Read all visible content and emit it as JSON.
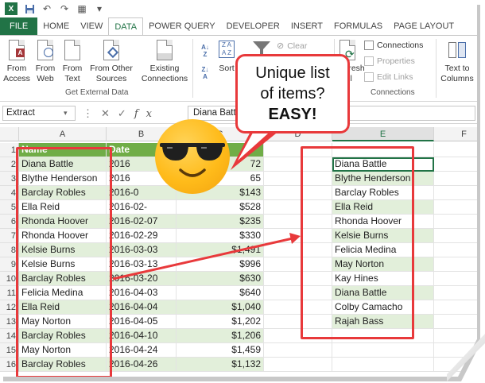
{
  "quick_access": {
    "icons": [
      "excel-logo",
      "save-icon",
      "undo-icon",
      "redo-icon",
      "form-icon",
      "customize-icon"
    ]
  },
  "tabs": [
    "FILE",
    "HOME",
    "VIEW",
    "DATA",
    "POWER QUERY",
    "DEVELOPER",
    "INSERT",
    "FORMULAS",
    "PAGE LAYOUT"
  ],
  "active_tab": "DATA",
  "ribbon": {
    "from_access": "From Access",
    "from_web": "From Web",
    "from_text": "From Text",
    "from_other": "From Other Sources",
    "existing_connections": "Existing Connections",
    "get_external_label": "Get External Data",
    "sort": "Sort",
    "clear": "Clear",
    "refresh": "Refresh All",
    "connections": "Connections",
    "properties": "Properties",
    "edit_links": "Edit Links",
    "connections_label": "Connections",
    "text_to_columns": "Text to Columns"
  },
  "formula_bar": {
    "name_box": "Extract",
    "content": "Diana Battle"
  },
  "columns": [
    "A",
    "B",
    "C",
    "D",
    "E",
    "F"
  ],
  "selected_column": "E",
  "rows": [
    {
      "n": "1",
      "name": "Name",
      "date": "Date",
      "amount": ""
    },
    {
      "n": "2",
      "name": "Diana Battle",
      "date": "2016",
      "amount": "72"
    },
    {
      "n": "3",
      "name": "Blythe Henderson",
      "date": "2016",
      "amount": "65"
    },
    {
      "n": "4",
      "name": "Barclay Robles",
      "date": "2016-0",
      "amount": "$143"
    },
    {
      "n": "5",
      "name": "Ella Reid",
      "date": "2016-02-",
      "amount": "$528"
    },
    {
      "n": "6",
      "name": "Rhonda Hoover",
      "date": "2016-02-07",
      "amount": "$235"
    },
    {
      "n": "7",
      "name": "Rhonda Hoover",
      "date": "2016-02-29",
      "amount": "$330"
    },
    {
      "n": "8",
      "name": "Kelsie Burns",
      "date": "2016-03-03",
      "amount": "$1,491"
    },
    {
      "n": "9",
      "name": "Kelsie Burns",
      "date": "2016-03-13",
      "amount": "$996"
    },
    {
      "n": "10",
      "name": "Barclay Robles",
      "date": "2016-03-20",
      "amount": "$630"
    },
    {
      "n": "11",
      "name": "Felicia Medina",
      "date": "2016-04-03",
      "amount": "$640"
    },
    {
      "n": "12",
      "name": "Ella Reid",
      "date": "2016-04-04",
      "amount": "$1,040"
    },
    {
      "n": "13",
      "name": "May Norton",
      "date": "2016-04-05",
      "amount": "$1,202"
    },
    {
      "n": "14",
      "name": "Barclay Robles",
      "date": "2016-04-10",
      "amount": "$1,206"
    },
    {
      "n": "15",
      "name": "May Norton",
      "date": "2016-04-24",
      "amount": "$1,459"
    },
    {
      "n": "16",
      "name": "Barclay Robles",
      "date": "2016-04-26",
      "amount": "$1,132"
    }
  ],
  "unique_list": [
    "Diana Battle",
    "Blythe Henderson",
    "Barclay Robles",
    "Ella Reid",
    "Rhonda Hoover",
    "Kelsie Burns",
    "Felicia Medina",
    "May Norton",
    "Kay Hines",
    "Diana Battle",
    "Colby Camacho",
    "Rajah Bass"
  ],
  "callout": {
    "line1": "Unique list",
    "line2": "of items?",
    "line3": "EASY!"
  },
  "colors": {
    "excel_green": "#217346",
    "header_green": "#70ad47",
    "band_green": "#e2efda",
    "annotation_red": "#e8393b",
    "emoji_yellow": "#ffbb1a"
  }
}
